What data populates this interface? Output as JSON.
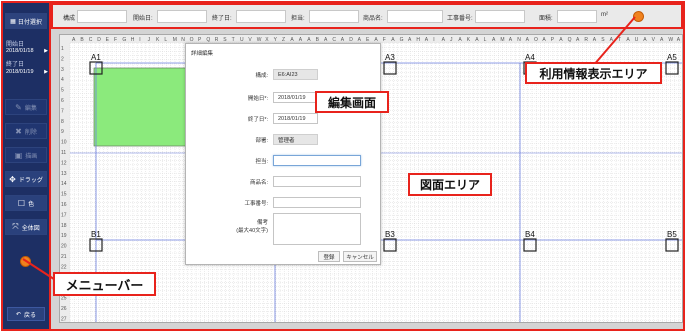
{
  "sidebar": {
    "date_select_label": "日付選択",
    "start_label": "開始日",
    "start_value": "2018/01/18",
    "end_label": "終了日",
    "end_value": "2018/01/19",
    "buttons": [
      {
        "label": "編集",
        "icon": "edit-icon",
        "active": false
      },
      {
        "label": "削除",
        "icon": "delete-icon",
        "active": false
      },
      {
        "label": "描画",
        "icon": "image-icon",
        "active": false
      },
      {
        "label": "ドラッグ",
        "icon": "move-icon",
        "active": true
      },
      {
        "label": "色",
        "icon": "square-icon",
        "active": true
      },
      {
        "label": "全体図",
        "icon": "expand-icon",
        "active": true
      }
    ],
    "back_label": "戻る"
  },
  "infobar": {
    "fields": [
      {
        "label": "構成",
        "value": ""
      },
      {
        "label": "開始日:",
        "value": ""
      },
      {
        "label": "終了日:",
        "value": ""
      },
      {
        "label": "担当:",
        "value": ""
      },
      {
        "label": "商品名:",
        "value": ""
      },
      {
        "label": "工事番号:",
        "value": ""
      },
      {
        "label": "面積:",
        "value": ""
      }
    ],
    "area_unit": "m²"
  },
  "drawing": {
    "column_letters": "ABCDEFGHIJKLMNOPQRSTUVWXYZAAABACADAEAFAGAHAIAJAKALAMANAOAPAQARASATAUAVAWAXAYAZBABBBCBDBEBFBG",
    "row_numbers": [
      "1",
      "2",
      "3",
      "4",
      "5",
      "6",
      "7",
      "8",
      "9",
      "10",
      "11",
      "12",
      "13",
      "14",
      "15",
      "16",
      "17",
      "18",
      "19",
      "20",
      "21",
      "22",
      "23",
      "24",
      "25",
      "26",
      "27"
    ],
    "markers": [
      "A1",
      "A3",
      "A4",
      "A5",
      "B1",
      "B3",
      "B4",
      "B5"
    ],
    "fill_color": "#8bea7c"
  },
  "dialog": {
    "title": "詳細編集",
    "fields": [
      {
        "label": "構成:",
        "value": "E6:AI23",
        "readonly": true
      },
      {
        "label": "開始日*:",
        "value": "2018/01/19",
        "readonly": false
      },
      {
        "label": "終了日*:",
        "value": "2018/01/19",
        "readonly": false
      },
      {
        "label": "部署:",
        "value": "管理者",
        "readonly": true
      },
      {
        "label": "担当:",
        "value": "",
        "readonly": false
      },
      {
        "label": "商品名:",
        "value": "",
        "readonly": false
      },
      {
        "label": "工事番号:",
        "value": "",
        "readonly": false
      }
    ],
    "remarks_label_1": "備考",
    "remarks_label_2": "(最大40文字)",
    "save_label": "登録",
    "cancel_label": "キャンセル"
  },
  "callouts": {
    "menu_bar": "メニューバー",
    "info_area": "利用情報表示エリア",
    "edit_screen": "編集画面",
    "drawing_area": "図面エリア"
  },
  "colors": {
    "annotation_red": "#e8231c",
    "sidebar_navy": "#1d2f64",
    "marker_orange": "#f0821e",
    "fill_green": "#8bea7c"
  }
}
